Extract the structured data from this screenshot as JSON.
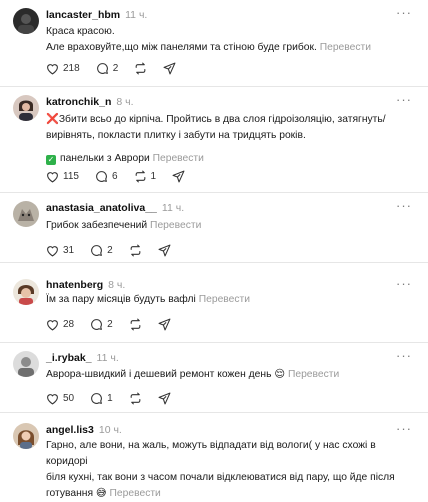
{
  "translate_label": "Перевести",
  "comments": [
    {
      "username": "lancaster_hbm",
      "time": "11 ч.",
      "lines": [
        "Краса красою.",
        "Але враховуйте,що між панелями та стіною буде грибок."
      ],
      "likes": "218",
      "replies": "2",
      "reposts": ""
    },
    {
      "username": "katronchik_n",
      "time": "8 ч.",
      "cross_icon": "❌",
      "lines": [
        "Збити всьо до кірпіча. Пройтись в два слоя гідроізоляцію, затягнуть/",
        "вирівнять, покласти плитку і забути на тридцять років."
      ],
      "tag_text": "панельки з Аврори",
      "likes": "115",
      "replies": "6",
      "reposts": "1"
    },
    {
      "username": "anastasia_anatoliva__",
      "time": "11 ч.",
      "lines": [
        "Грибок забезпечений"
      ],
      "likes": "31",
      "replies": "2",
      "reposts": ""
    },
    {
      "username": "hnatenberg",
      "time": "8 ч.",
      "lines": [
        "Їм за пару місяців будуть вафлі"
      ],
      "likes": "28",
      "replies": "2",
      "reposts": ""
    },
    {
      "username": "_i.rybak_",
      "time": "11 ч.",
      "lines": [
        "Аврора-швидкий і дешевий ремонт кожен день"
      ],
      "emoji": "😌",
      "likes": "50",
      "replies": "1",
      "reposts": ""
    },
    {
      "username": "angel.lis3",
      "time": "10 ч.",
      "lines": [
        "Гарно, але вони, на жаль, можуть відпадати від вологи( у нас схожі в коридорі",
        "біля кухні, так вони з часом почали відклеюватися від пару, що йде після",
        "готування"
      ],
      "emoji": "😅",
      "likes": "",
      "replies": "",
      "reposts": ""
    }
  ]
}
